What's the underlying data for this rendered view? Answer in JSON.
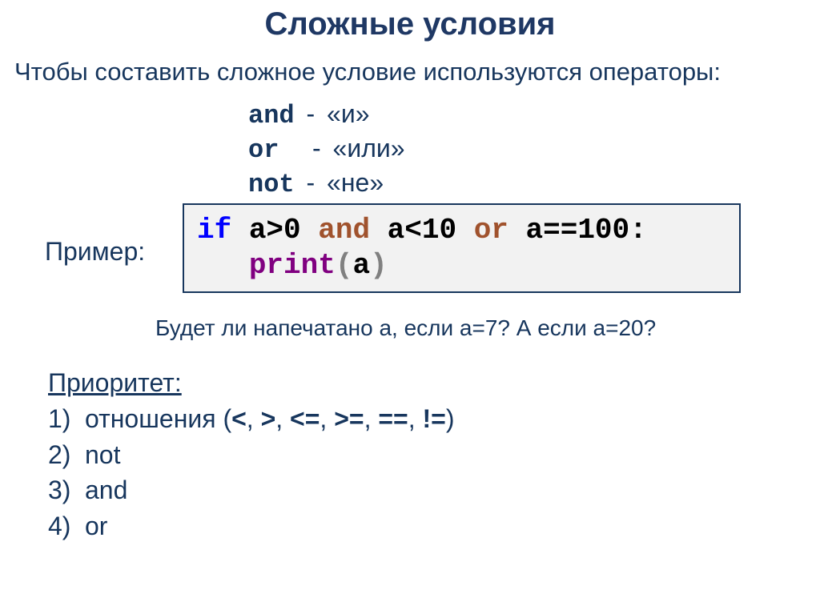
{
  "title": "Сложные условия",
  "intro": "Чтобы составить сложное условие используются операторы:",
  "operators": {
    "and_kw": "and",
    "and_def": "«и»",
    "or_kw": "or",
    "or_def": "«или»",
    "not_kw": "not",
    "not_def": "«не»"
  },
  "example_label": "Пример:",
  "code": {
    "if_kw": "if",
    "expr1": " a>0 ",
    "and_kw": "and",
    "expr2": " a<10 ",
    "or_kw": "or",
    "expr3": " a==100",
    "colon": ":",
    "indent": "   ",
    "print_fn": "print",
    "lparen": "(",
    "arg": "a",
    "rparen": ")"
  },
  "question": "Будет ли напечатано а, если а=7? А если а=20?",
  "priority_heading": "Приоритет:",
  "priority": {
    "n1": "1)",
    "p1_a": "отношения (",
    "p1_b": "<",
    "p1_c": ", ",
    "p1_d": ">",
    "p1_e": ", ",
    "p1_f": "<=",
    "p1_g": ", ",
    "p1_h": ">=",
    "p1_i": ", ",
    "p1_j": "==",
    "p1_k": ", ",
    "p1_l": "!=",
    "p1_m": ")",
    "n2": "2)",
    "p2": "not",
    "n3": "3)",
    "p3": "and",
    "n4": "4)",
    "p4": "or"
  }
}
